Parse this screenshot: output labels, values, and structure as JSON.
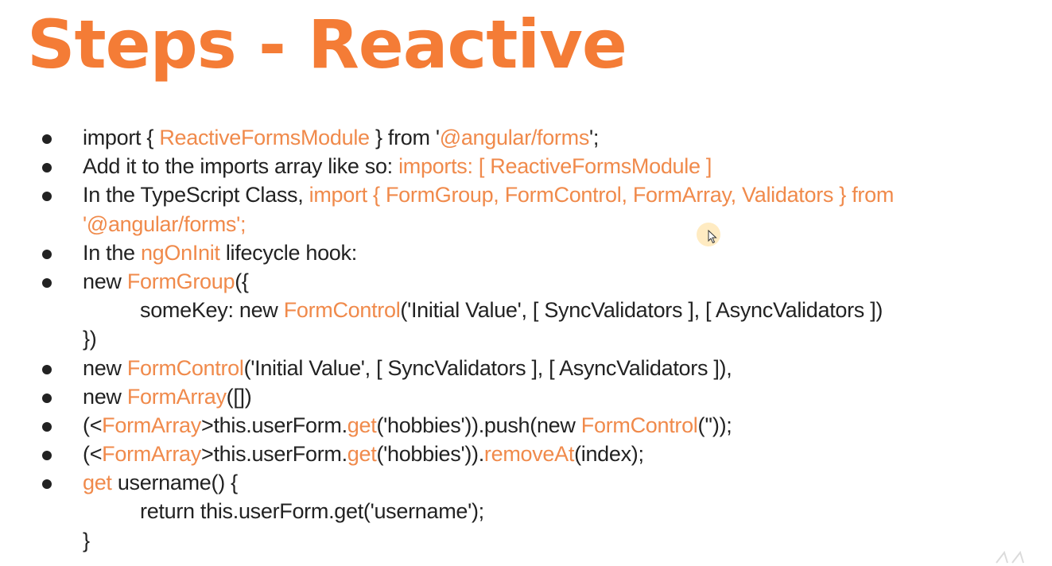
{
  "slide": {
    "title": "Steps - Reactive"
  },
  "bullets": [
    {
      "bullet": true,
      "indent": false,
      "segments": [
        {
          "t": "import { ",
          "c": "k"
        },
        {
          "t": "ReactiveFormsModule",
          "c": "o"
        },
        {
          "t": " } from '",
          "c": "k"
        },
        {
          "t": "@angular/forms",
          "c": "o"
        },
        {
          "t": "';",
          "c": "k"
        }
      ]
    },
    {
      "bullet": true,
      "indent": false,
      "segments": [
        {
          "t": "Add it to the imports array like so: ",
          "c": "k"
        },
        {
          "t": "imports: [ ReactiveFormsModule ]",
          "c": "o"
        }
      ]
    },
    {
      "bullet": true,
      "indent": false,
      "segments": [
        {
          "t": "In the TypeScript Class, ",
          "c": "k"
        },
        {
          "t": "import { FormGroup, FormControl, FormArray, Validators } from",
          "c": "o"
        }
      ]
    },
    {
      "bullet": false,
      "indent": false,
      "segments": [
        {
          "t": "'@angular/forms';",
          "c": "o"
        }
      ]
    },
    {
      "bullet": true,
      "indent": false,
      "segments": [
        {
          "t": "In the ",
          "c": "k"
        },
        {
          "t": "ngOnInit",
          "c": "o"
        },
        {
          "t": " lifecycle hook:",
          "c": "k"
        }
      ]
    },
    {
      "bullet": true,
      "indent": false,
      "segments": [
        {
          "t": "new ",
          "c": "k"
        },
        {
          "t": "FormGroup",
          "c": "o"
        },
        {
          "t": "({",
          "c": "k"
        }
      ]
    },
    {
      "bullet": false,
      "indent": true,
      "segments": [
        {
          "t": "someKey: new ",
          "c": "k"
        },
        {
          "t": "FormControl",
          "c": "o"
        },
        {
          "t": "('Initial Value', [ SyncValidators ], [ AsyncValidators ])",
          "c": "k"
        }
      ]
    },
    {
      "bullet": false,
      "indent": false,
      "segments": [
        {
          "t": "})",
          "c": "k"
        }
      ]
    },
    {
      "bullet": true,
      "indent": false,
      "segments": [
        {
          "t": "new ",
          "c": "k"
        },
        {
          "t": "FormControl",
          "c": "o"
        },
        {
          "t": "('Initial Value', [ SyncValidators ], [ AsyncValidators ]),",
          "c": "k"
        }
      ]
    },
    {
      "bullet": true,
      "indent": false,
      "segments": [
        {
          "t": "new ",
          "c": "k"
        },
        {
          "t": "FormArray",
          "c": "o"
        },
        {
          "t": "([])",
          "c": "k"
        }
      ]
    },
    {
      "bullet": true,
      "indent": false,
      "segments": [
        {
          "t": "(<",
          "c": "k"
        },
        {
          "t": "FormArray",
          "c": "o"
        },
        {
          "t": ">this.userForm.",
          "c": "k"
        },
        {
          "t": "get",
          "c": "o"
        },
        {
          "t": "('hobbies')).push(new ",
          "c": "k"
        },
        {
          "t": "FormControl",
          "c": "o"
        },
        {
          "t": "(''));",
          "c": "k"
        }
      ]
    },
    {
      "bullet": true,
      "indent": false,
      "segments": [
        {
          "t": "(<",
          "c": "k"
        },
        {
          "t": "FormArray",
          "c": "o"
        },
        {
          "t": ">this.userForm.",
          "c": "k"
        },
        {
          "t": "get",
          "c": "o"
        },
        {
          "t": "('hobbies')).",
          "c": "k"
        },
        {
          "t": "removeAt",
          "c": "o"
        },
        {
          "t": "(index);",
          "c": "k"
        }
      ]
    },
    {
      "bullet": true,
      "indent": false,
      "segments": [
        {
          "t": "get",
          "c": "o"
        },
        {
          "t": " username() {",
          "c": "k"
        }
      ]
    },
    {
      "bullet": false,
      "indent": true,
      "segments": [
        {
          "t": "return this.userForm.get('username');",
          "c": "k"
        }
      ]
    },
    {
      "bullet": false,
      "indent": false,
      "segments": [
        {
          "t": "}",
          "c": "k"
        }
      ]
    }
  ],
  "colors": {
    "title": "#f47c36",
    "highlight": "#f08a4b",
    "text": "#222222"
  },
  "icons": {
    "cursor": "mouse-cursor-icon",
    "bullet": "bullet-dot-icon"
  }
}
